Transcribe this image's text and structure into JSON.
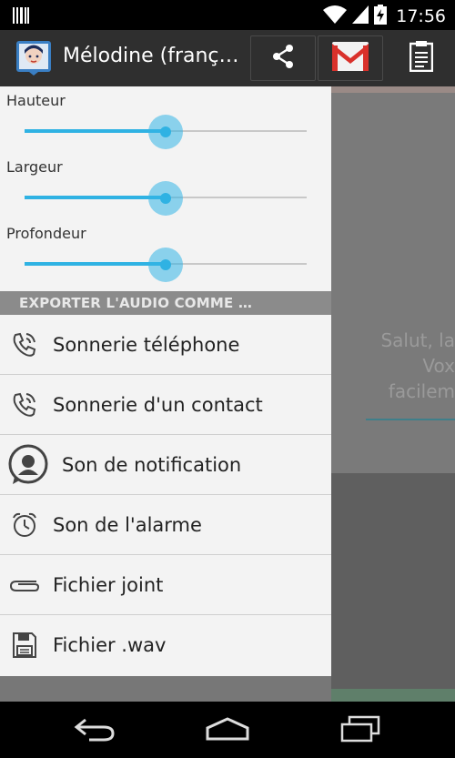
{
  "status_bar": {
    "time": "17:56",
    "icons": [
      "barcode-icon",
      "wifi-icon",
      "signal-icon",
      "battery-charging-icon"
    ]
  },
  "action_bar": {
    "title": "Mélodine (franç…",
    "app_icon": "app-avatar-icon",
    "actions": [
      "share-icon",
      "gmail-icon",
      "clipboard-icon"
    ]
  },
  "drawer": {
    "sliders": [
      {
        "label": "Hauteur",
        "value": 0.5
      },
      {
        "label": "Largeur",
        "value": 0.5
      },
      {
        "label": "Profondeur",
        "value": 0.5
      }
    ],
    "section_header": "EXPORTER L'AUDIO COMME …",
    "items": [
      {
        "label": "Sonnerie téléphone",
        "icon": "phone-ringing-icon"
      },
      {
        "label": "Sonnerie d'un contact",
        "icon": "phone-ringing-icon"
      },
      {
        "label": "Son de notification",
        "icon": "notification-bubble-icon"
      },
      {
        "label": "Son de l'alarme",
        "icon": "alarm-clock-icon"
      },
      {
        "label": "Fichier joint",
        "icon": "paperclip-icon"
      },
      {
        "label": "Fichier .wav",
        "icon": "save-icon"
      }
    ]
  },
  "background_content": {
    "lines": [
      "Salut, la",
      "Vox",
      "facilem"
    ]
  },
  "nav_bar": {
    "buttons": [
      "back-icon",
      "home-icon",
      "recent-apps-icon"
    ]
  },
  "colors": {
    "accent": "#33b5e5",
    "action_bar": "#2f2f2f",
    "drawer_bg": "#f3f3f3",
    "section_header": "#8b8b8b"
  }
}
